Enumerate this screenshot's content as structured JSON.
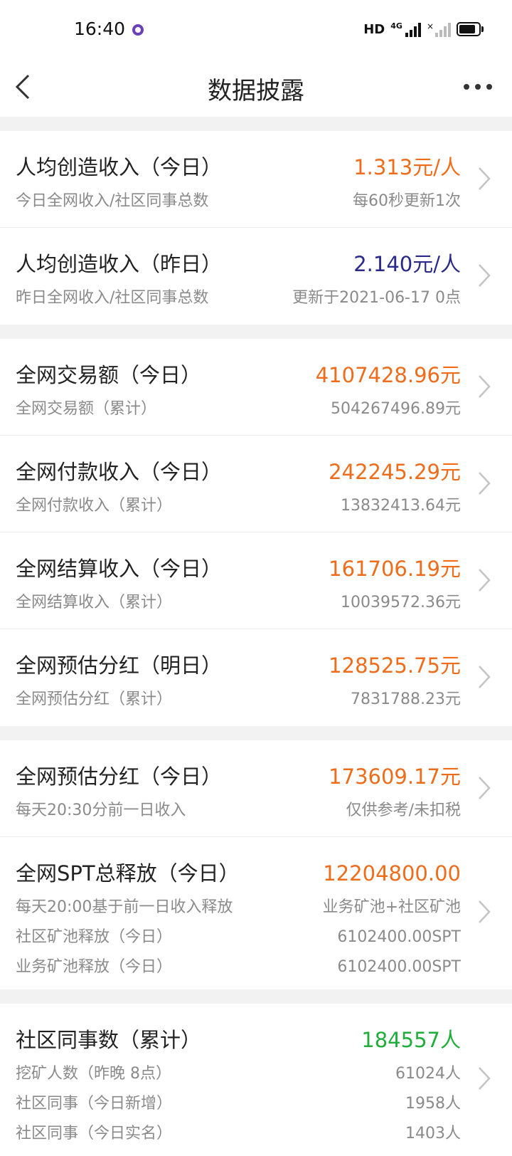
{
  "status": {
    "time": "16:40",
    "hd": "HD",
    "net": "4G"
  },
  "nav": {
    "title": "数据披露"
  },
  "colors": {
    "orange": "#ef6c1a",
    "navy": "#2a2a8a",
    "green": "#1fae3a"
  },
  "groups": [
    {
      "rows": [
        {
          "title": "人均创造收入（今日）",
          "value": "1.313元/人",
          "sub": "今日全网收入/社区同事总数",
          "sub_value": "每60秒更新1次"
        },
        {
          "title": "人均创造收入（昨日）",
          "value": "2.140元/人",
          "sub": "昨日全网收入/社区同事总数",
          "sub_value": "更新于2021-06-17 0点"
        }
      ]
    },
    {
      "rows": [
        {
          "title": "全网交易额（今日）",
          "value": "4107428.96元",
          "sub": "全网交易额（累计）",
          "sub_value": "504267496.89元"
        },
        {
          "title": "全网付款收入（今日）",
          "value": "242245.29元",
          "sub": "全网付款收入（累计）",
          "sub_value": "13832413.64元"
        },
        {
          "title": "全网结算收入（今日）",
          "value": "161706.19元",
          "sub": "全网结算收入（累计）",
          "sub_value": "10039572.36元"
        },
        {
          "title": "全网预估分红（明日）",
          "value": "128525.75元",
          "sub": "全网预估分红（累计）",
          "sub_value": "7831788.23元"
        }
      ]
    },
    {
      "rows": [
        {
          "title": "全网预估分红（今日）",
          "value": "173609.17元",
          "sub": "每天20:30分前一日收入",
          "sub_value": "仅供参考/未扣税"
        },
        {
          "title": "全网SPT总释放（今日）",
          "value": "12204800.00",
          "sub": "每天20:00基于前一日收入释放",
          "sub_value": "业务矿池+社区矿池",
          "extra": [
            {
              "label": "社区矿池释放（今日）",
              "value": "6102400.00SPT"
            },
            {
              "label": "业务矿池释放（今日）",
              "value": "6102400.00SPT"
            }
          ]
        }
      ]
    },
    {
      "rows": [
        {
          "title": "社区同事数（累计）",
          "value": "184557人",
          "sub": "挖矿人数（昨晚 8点）",
          "sub_value": "61024人",
          "extra": [
            {
              "label": "社区同事（今日新增）",
              "value": "1958人"
            },
            {
              "label": "社区同事（今日实名）",
              "value": "1403人"
            }
          ]
        }
      ]
    }
  ]
}
